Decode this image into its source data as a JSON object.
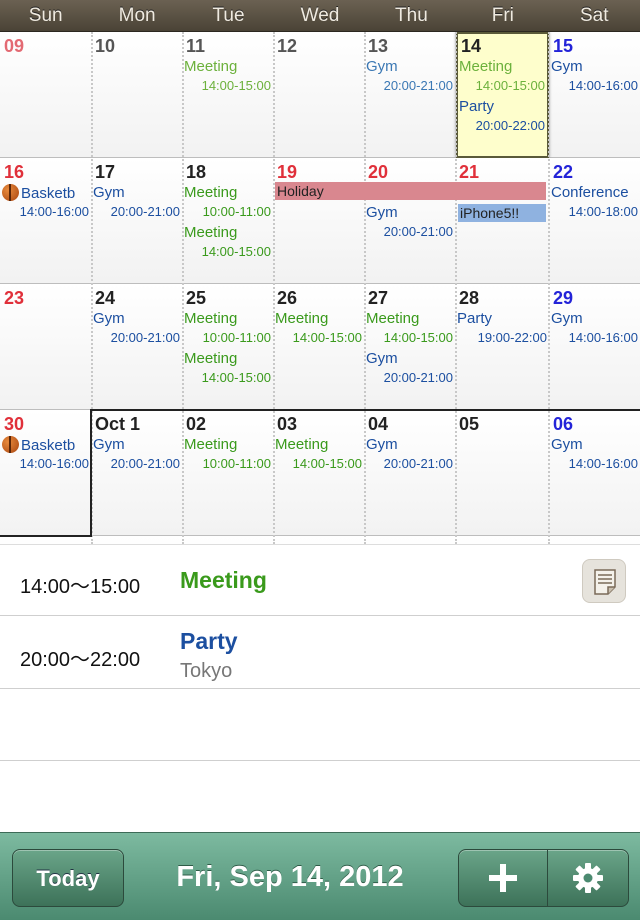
{
  "weekdays": [
    "Sun",
    "Mon",
    "Tue",
    "Wed",
    "Thu",
    "Fri",
    "Sat"
  ],
  "weeks": [
    {
      "days": [
        "09",
        "10",
        "11",
        "12",
        "13",
        "14",
        "15"
      ],
      "events": {
        "tue": [
          {
            "title": "Meeting",
            "time": "14:00-15:00"
          }
        ],
        "thu": [
          {
            "title": "Gym",
            "time": "20:00-21:00"
          }
        ],
        "fri": [
          {
            "title": "Meeting",
            "time": "14:00-15:00"
          },
          {
            "title": "Party",
            "time": "20:00-22:00"
          }
        ],
        "sat": [
          {
            "title": "Gym",
            "time": "14:00-16:00"
          }
        ]
      }
    },
    {
      "days": [
        "16",
        "17",
        "18",
        "19",
        "20",
        "21",
        "22"
      ],
      "events": {
        "sun": [
          {
            "title": "Basketb",
            "time": "14:00-16:00"
          }
        ],
        "mon": [
          {
            "title": "Gym",
            "time": "20:00-21:00"
          }
        ],
        "tue": [
          {
            "title": "Meeting",
            "time": "10:00-11:00"
          },
          {
            "title": "Meeting",
            "time": "14:00-15:00"
          }
        ],
        "thu": [
          {
            "title": "Gym",
            "time": "20:00-21:00"
          }
        ],
        "sat": [
          {
            "title": "Conference",
            "time": "14:00-18:00"
          }
        ]
      },
      "holiday": "Holiday",
      "banner": "iPhone5!!"
    },
    {
      "days": [
        "23",
        "24",
        "25",
        "26",
        "27",
        "28",
        "29"
      ],
      "events": {
        "mon": [
          {
            "title": "Gym",
            "time": "20:00-21:00"
          }
        ],
        "tue": [
          {
            "title": "Meeting",
            "time": "10:00-11:00"
          },
          {
            "title": "Meeting",
            "time": "14:00-15:00"
          }
        ],
        "wed": [
          {
            "title": "Meeting",
            "time": "14:00-15:00"
          }
        ],
        "thu": [
          {
            "title": "Meeting",
            "time": "14:00-15:00"
          },
          {
            "title": "Gym",
            "time": "20:00-21:00"
          }
        ],
        "fri": [
          {
            "title": "Party",
            "time": "19:00-22:00"
          }
        ],
        "sat": [
          {
            "title": "Gym",
            "time": "14:00-16:00"
          }
        ]
      }
    },
    {
      "days": [
        "30",
        "Oct 1",
        "02",
        "03",
        "04",
        "05",
        "06"
      ],
      "events": {
        "sun": [
          {
            "title": "Basketb",
            "time": "14:00-16:00"
          }
        ],
        "mon": [
          {
            "title": "Gym",
            "time": "20:00-21:00"
          }
        ],
        "tue": [
          {
            "title": "Meeting",
            "time": "10:00-11:00"
          }
        ],
        "wed": [
          {
            "title": "Meeting",
            "time": "14:00-15:00"
          }
        ],
        "thu": [
          {
            "title": "Gym",
            "time": "20:00-21:00"
          }
        ],
        "sat": [
          {
            "title": "Gym",
            "time": "14:00-16:00"
          }
        ]
      }
    }
  ],
  "event_list": [
    {
      "time": "14:00～15:00",
      "title": "Meeting",
      "location": ""
    },
    {
      "time": "20:00～22:00",
      "title": "Party",
      "location": "Tokyo"
    }
  ],
  "toolbar": {
    "today_label": "Today",
    "date_title": "Fri, Sep 14, 2012"
  },
  "colors": {
    "header": "#4a4336",
    "toolbar": "#4b8a70",
    "selected_day": "#fefecc",
    "meeting": "#3a9a1c",
    "party": "#1c4fa0",
    "holiday_bar": "#d9878f",
    "banner_bar": "#8fb2e0"
  },
  "icons": {
    "memo": "memo-icon",
    "add": "plus-icon",
    "settings": "gear-icon",
    "basketball": "basketball-icon"
  }
}
